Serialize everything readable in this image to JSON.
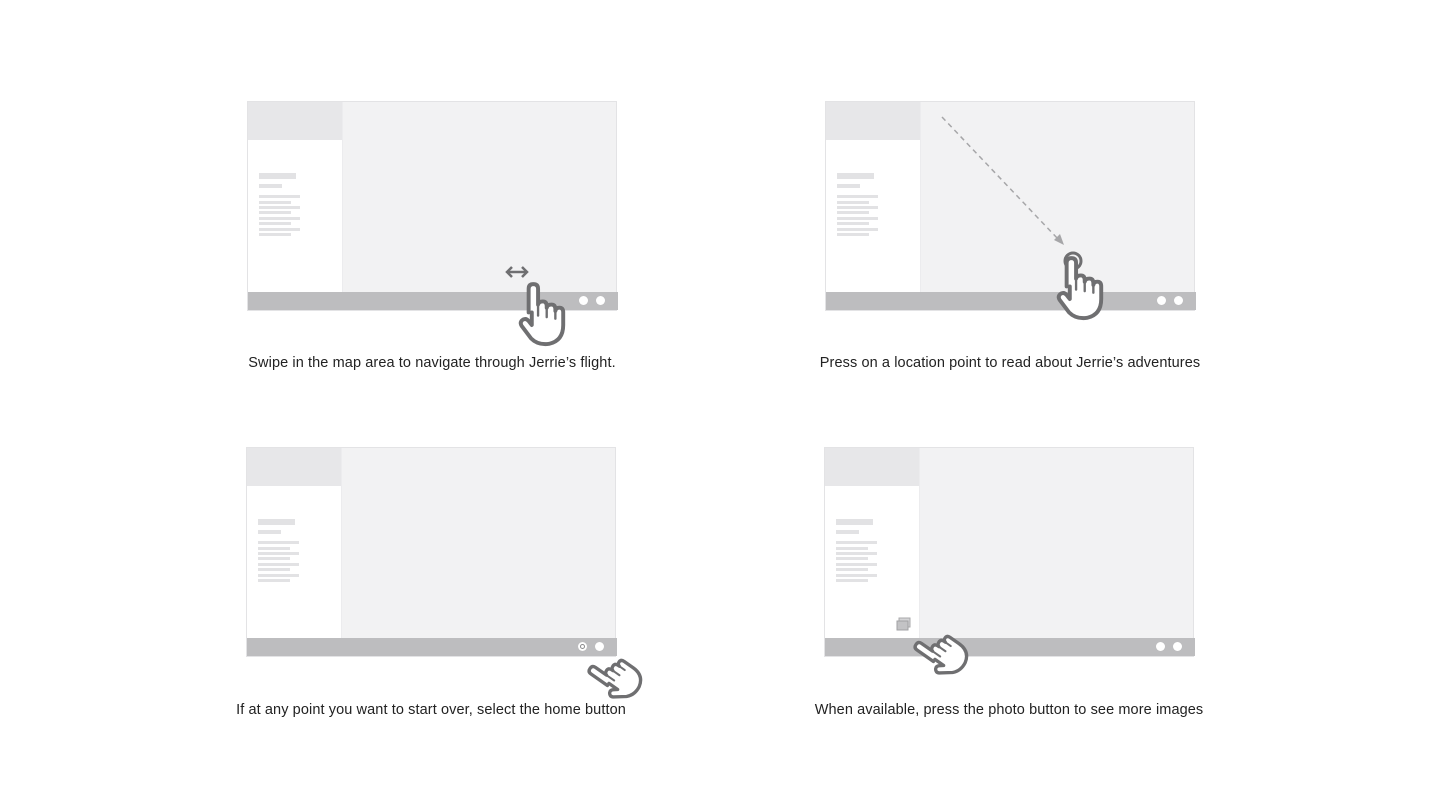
{
  "panels": [
    {
      "id": "swipe",
      "caption": "Swipe in the map area to navigate through Jerrie’s flight.",
      "icon": "swipe-hand-icon"
    },
    {
      "id": "press-location",
      "caption": "Press on a location point to read about Jerrie’s adventures",
      "icon": "tap-hand-icon"
    },
    {
      "id": "home",
      "caption": "If at any point you want to start over, select the home button",
      "icon": "tap-hand-icon"
    },
    {
      "id": "photo",
      "caption": "When available, press the photo button to see more images",
      "icon": "tap-hand-icon"
    }
  ],
  "colors": {
    "background": "#ffffff",
    "map": "#f2f2f3",
    "sidebar_header": "#e7e7e9",
    "footer": "#bdbdbf",
    "hand_stroke": "#6f6f71",
    "caption_text": "#222222"
  }
}
